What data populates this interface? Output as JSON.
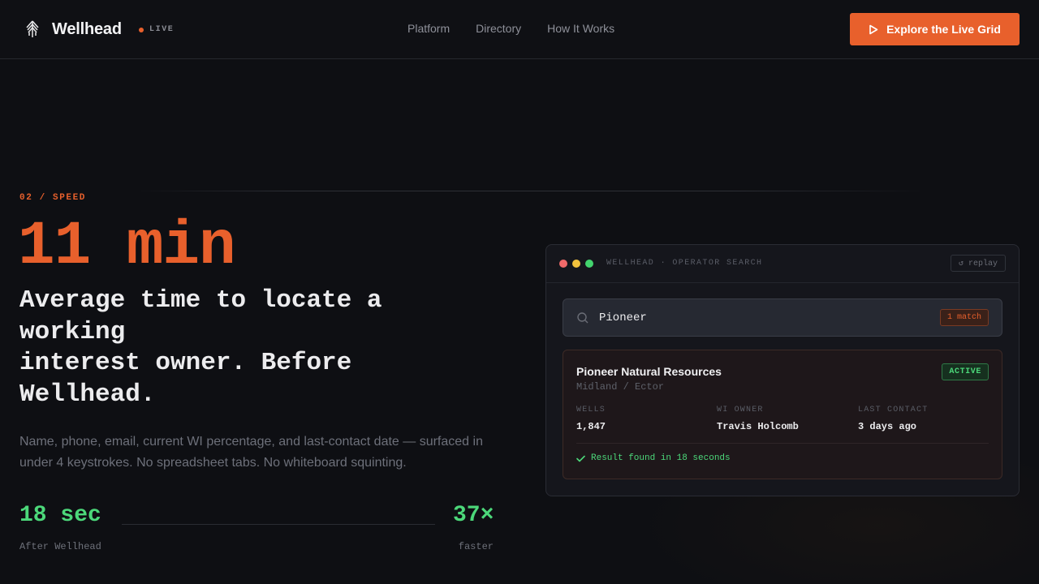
{
  "nav": {
    "brand": "Wellhead",
    "live": "LIVE",
    "links": [
      "Platform",
      "Directory",
      "How It Works"
    ],
    "cta": "Explore the Live Grid"
  },
  "hero": {
    "eyebrow": "02 / SPEED",
    "stat": "11 min",
    "headline_1": "Average time to locate a working",
    "headline_2": "interest owner. Before Wellhead.",
    "subcopy": "Name, phone, email, current WI percentage, and last-contact date — surfaced in under 4 keystrokes. No spreadsheet tabs. No whiteboard squinting.",
    "metric_left_value": "18 sec",
    "metric_left_label": "After Wellhead",
    "metric_right_value": "37×",
    "metric_right_label": "faster"
  },
  "window": {
    "title": "WELLHEAD · OPERATOR SEARCH",
    "replay": "↺ replay",
    "search_value": "Pioneer",
    "match": "1 match",
    "card": {
      "title": "Pioneer Natural Resources",
      "subtitle": "Midland / Ector",
      "badge": "ACTIVE",
      "fields": [
        {
          "label": "WELLS",
          "value": "1,847"
        },
        {
          "label": "WI OWNER",
          "value": "Travis Holcomb"
        },
        {
          "label": "LAST CONTACT",
          "value": "3 days ago"
        }
      ],
      "result": "Result found in 18 seconds"
    }
  },
  "colors": {
    "accent": "#e8602c",
    "success": "#4cd87a",
    "background": "#0e0f13"
  }
}
